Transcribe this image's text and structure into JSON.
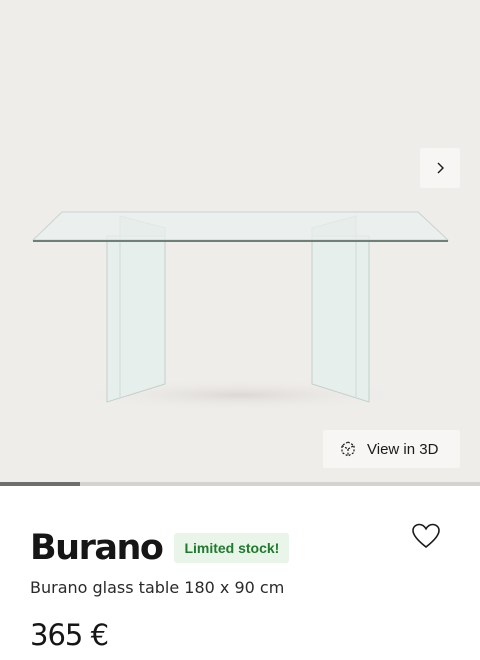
{
  "gallery": {
    "next_icon": "chevron-right-icon",
    "view3d_icon": "cube-3d-icon",
    "view3d_label": "View in 3D",
    "progress": 0.167
  },
  "product": {
    "name": "Burano",
    "stock_badge": "Limited stock!",
    "favorite_icon": "heart-icon",
    "subtitle": "Burano glass table 180 x 90 cm",
    "price": "365 €"
  },
  "colors": {
    "gallery_bg": "#efedea",
    "badge_bg": "#e9f5e8",
    "badge_text": "#1f7a2e",
    "progress_fill": "#6e6e6e"
  }
}
